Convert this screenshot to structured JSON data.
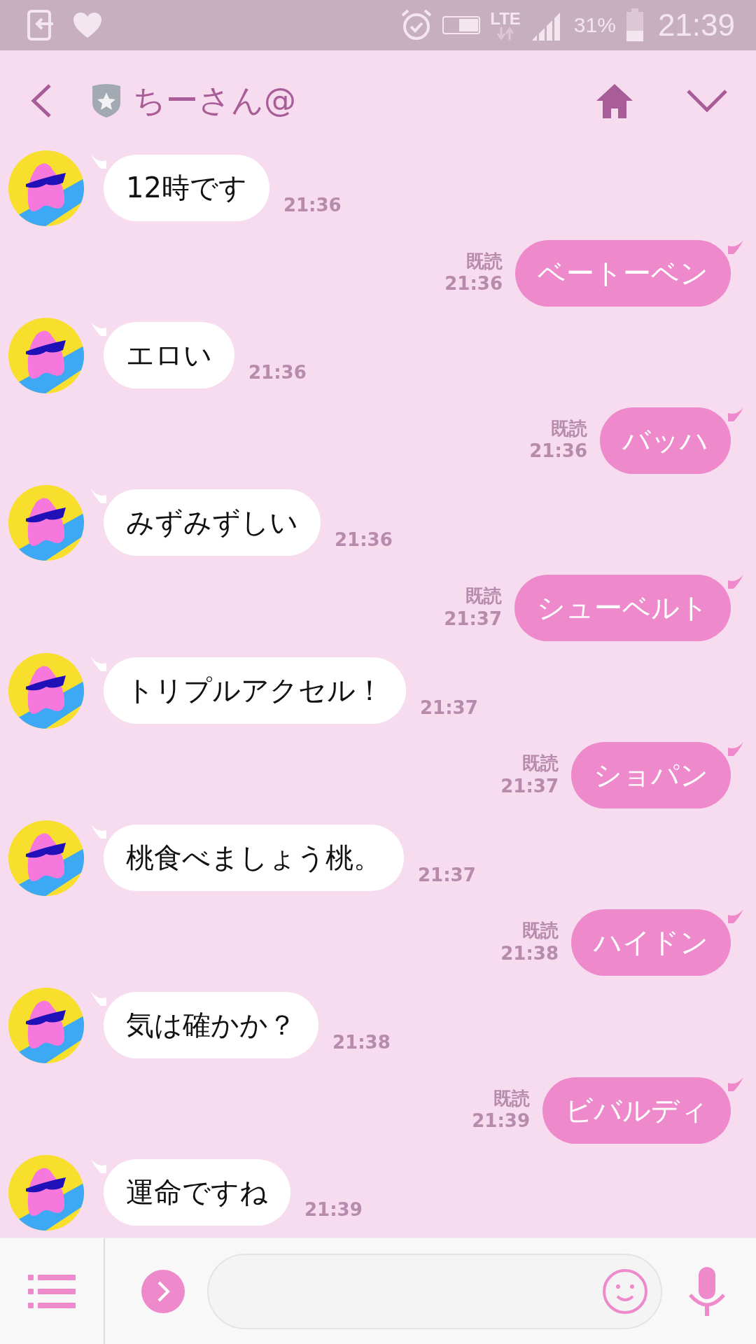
{
  "status_bar": {
    "battery": "31%",
    "time": "21:39",
    "network": "LTE"
  },
  "header": {
    "title": "ちーさん@"
  },
  "messages": [
    {
      "kind": "in",
      "text": "12時です",
      "time": "21:36"
    },
    {
      "kind": "out",
      "text": "ベートーベン",
      "time": "21:36",
      "read_label": "既読"
    },
    {
      "kind": "in",
      "text": "エロい",
      "time": "21:36"
    },
    {
      "kind": "out",
      "text": "バッハ",
      "time": "21:36",
      "read_label": "既読"
    },
    {
      "kind": "in",
      "text": "みずみずしい",
      "time": "21:36"
    },
    {
      "kind": "out",
      "text": "シューベルト",
      "time": "21:37",
      "read_label": "既読"
    },
    {
      "kind": "in",
      "text": "トリプルアクセル！",
      "time": "21:37"
    },
    {
      "kind": "out",
      "text": "ショパン",
      "time": "21:37",
      "read_label": "既読"
    },
    {
      "kind": "in",
      "text": "桃食べましょう桃。",
      "time": "21:37"
    },
    {
      "kind": "out",
      "text": "ハイドン",
      "time": "21:38",
      "read_label": "既読"
    },
    {
      "kind": "in",
      "text": "気は確かか？",
      "time": "21:38"
    },
    {
      "kind": "out",
      "text": "ビバルディ",
      "time": "21:39",
      "read_label": "既読"
    },
    {
      "kind": "in",
      "text": "運命ですね",
      "time": "21:39"
    }
  ]
}
